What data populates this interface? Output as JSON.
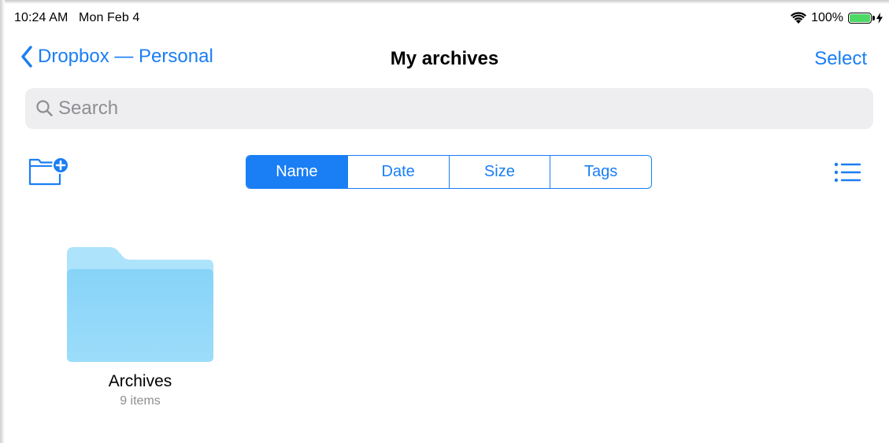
{
  "status_bar": {
    "time": "10:24 AM",
    "date": "Mon Feb 4",
    "battery_percent": "100%",
    "icons": [
      "wifi-icon",
      "battery-icon",
      "charging-bolt-icon"
    ]
  },
  "nav": {
    "back_label": "Dropbox — Personal",
    "title": "My archives",
    "select_label": "Select"
  },
  "search": {
    "placeholder": "Search"
  },
  "toolbar": {
    "sort_options": [
      {
        "label": "Name",
        "selected": true
      },
      {
        "label": "Date",
        "selected": false
      },
      {
        "label": "Size",
        "selected": false
      },
      {
        "label": "Tags",
        "selected": false
      }
    ],
    "icons": [
      "new-folder-icon",
      "list-view-icon"
    ]
  },
  "items": [
    {
      "name": "Archives",
      "count": "9 items",
      "icon": "folder-icon"
    }
  ],
  "colors": {
    "accent": "#1a7ef5",
    "folder_light": "#aee3fc",
    "folder_dark": "#7fd0f7",
    "battery": "#4cd964"
  }
}
